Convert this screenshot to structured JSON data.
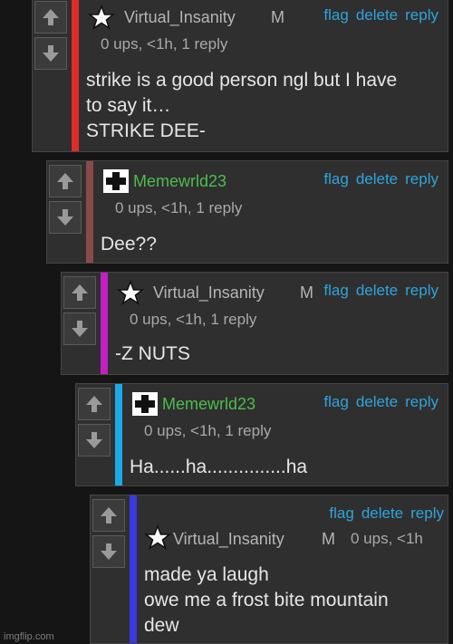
{
  "thread": {
    "comments": [
      {
        "username": "Virtual_Insanity",
        "role_badge": "M",
        "meta": "0 ups, <1h, 1 reply",
        "text": "strike is a good person ngl but I have\nto say it…\nSTRIKE DEE-",
        "bar_color": "#e02b2b",
        "avatar_icon": "star-icon",
        "actions": [
          "flag",
          "delete",
          "reply"
        ]
      },
      {
        "username": "Memewrld23",
        "meta": "0 ups, <1h, 1 reply",
        "text": "Dee??",
        "bar_color": "#8a4a4a",
        "avatar_icon": "cross-icon",
        "actions": [
          "flag",
          "delete",
          "reply"
        ]
      },
      {
        "username": "Virtual_Insanity",
        "role_badge": "M",
        "meta": "0 ups, <1h, 1 reply",
        "text": "-Z NUTS",
        "bar_color": "#c31fc3",
        "avatar_icon": "star-icon",
        "actions": [
          "flag",
          "delete",
          "reply"
        ]
      },
      {
        "username": "Memewrld23",
        "meta": "0 ups, <1h, 1 reply",
        "text": "Ha......ha...............ha",
        "bar_color": "#1da8e6",
        "avatar_icon": "cross-icon",
        "actions": [
          "flag",
          "delete",
          "reply"
        ]
      },
      {
        "username": "Virtual_Insanity",
        "role_badge": "M",
        "meta": "0 ups, <1h",
        "text": "made ya laugh\nowe me a frost bite mountain\ndew",
        "bar_color": "#3a3ae0",
        "avatar_icon": "star-icon",
        "actions": [
          "flag",
          "delete",
          "reply"
        ]
      }
    ]
  },
  "watermark": "imgflip.com"
}
